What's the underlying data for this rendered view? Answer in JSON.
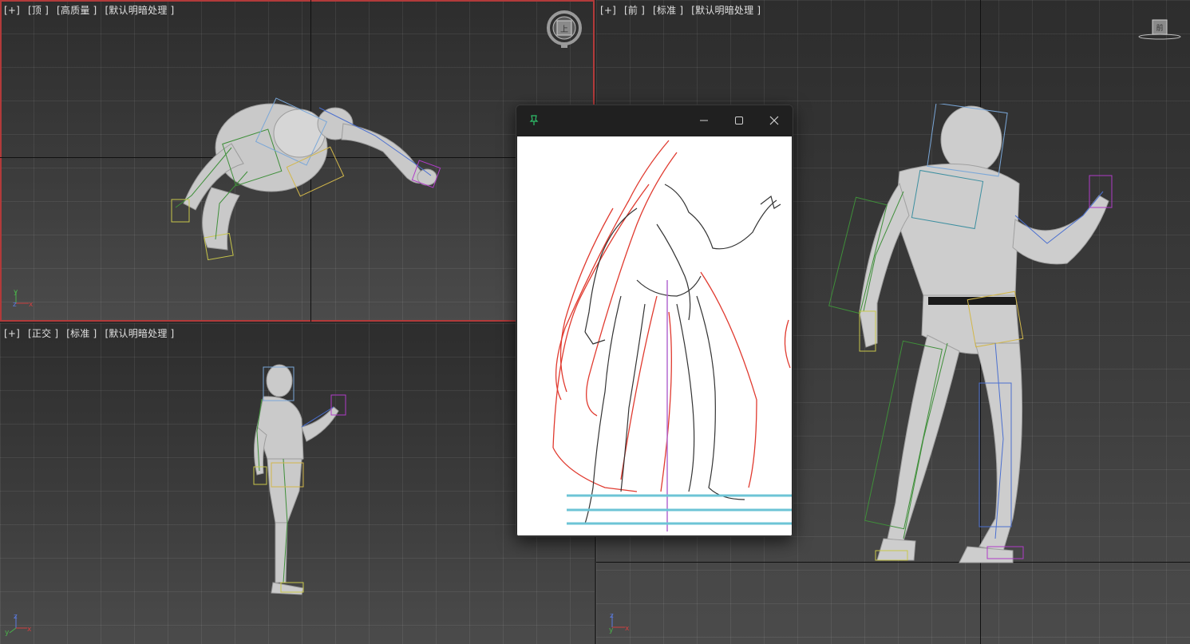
{
  "viewports": {
    "top": {
      "plus": "[+]",
      "view": "[顶 ]",
      "shading": "[高质量 ]",
      "lighting": "[默认明暗处理 ]"
    },
    "ortho": {
      "plus": "[+]",
      "view": "[正交 ]",
      "shading": "[标准 ]",
      "lighting": "[默认明暗处理 ]"
    },
    "front": {
      "plus": "[+]",
      "view": "[前 ]",
      "shading": "[标准 ]",
      "lighting": "[默认明暗处理 ]"
    }
  },
  "viewcube": {
    "top_face": "上",
    "front_face": "前"
  },
  "axes": {
    "top": [
      "y",
      "z",
      "x"
    ],
    "ortho": [
      "z",
      "y",
      "x"
    ],
    "front": [
      "z",
      "y",
      "x"
    ]
  },
  "colors": {
    "active_border": "#b23a3a",
    "bone_green": "#3f8f3a",
    "bone_blue": "#4a6fd0",
    "bone_magenta": "#b03cc8",
    "sketch_red": "#e03a2f",
    "guide_cyan": "#6cc4d6"
  },
  "icons": {
    "pin": "pin-icon",
    "minimize": "minimize-icon",
    "maximize": "maximize-icon",
    "close": "close-icon"
  }
}
